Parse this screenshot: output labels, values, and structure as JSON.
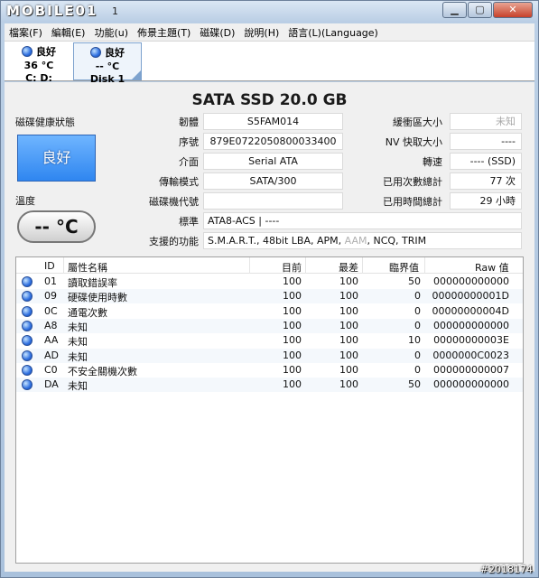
{
  "window": {
    "logo": "MOBILE01",
    "title": "1"
  },
  "menu": [
    "檔案(F)",
    "編輯(E)",
    "功能(u)",
    "佈景主題(T)",
    "磁碟(D)",
    "說明(H)",
    "語言(L)(Language)"
  ],
  "disk_tabs": [
    {
      "status": "良好",
      "temp": "36 °C",
      "drive": "C: D:"
    },
    {
      "status": "良好",
      "temp": "-- °C",
      "drive": "Disk 1"
    }
  ],
  "model": "SATA SSD  20.0 GB",
  "left_panel": {
    "health_label": "磁碟健康狀態",
    "health_value": "良好",
    "temp_label": "溫度",
    "temp_value": "-- °C"
  },
  "info": {
    "firmware_label": "韌體",
    "firmware": "S5FAM014",
    "serial_label": "序號",
    "serial": "879E0722050800033400",
    "interface_label": "介面",
    "interface": "Serial ATA",
    "transfer_label": "傳輸模式",
    "transfer": "SATA/300",
    "drive_letter_label": "磁碟機代號",
    "drive_letter": "",
    "standard_label": "標準",
    "standard": "ATA8-ACS | ----",
    "features_label": "支援的功能",
    "features_a": "S.M.A.R.T., 48bit LBA, APM, ",
    "features_aam": "AAM",
    "features_b": ", NCQ, TRIM",
    "buffer_label": "緩衝區大小",
    "buffer": "未知",
    "nvcache_label": "NV 快取大小",
    "nvcache": "----",
    "rotation_label": "轉速",
    "rotation": "---- (SSD)",
    "power_count_label": "已用次數總計",
    "power_count": "77 次",
    "power_hours_label": "已用時間總計",
    "power_hours": "29 小時"
  },
  "smart_table": {
    "headers": [
      "ID",
      "屬性名稱",
      "目前",
      "最差",
      "臨界值",
      "Raw 值"
    ],
    "rows": [
      {
        "id": "01",
        "name": "讀取錯誤率",
        "current": "100",
        "worst": "100",
        "threshold": "50",
        "raw": "000000000000"
      },
      {
        "id": "09",
        "name": "硬碟使用時數",
        "current": "100",
        "worst": "100",
        "threshold": "0",
        "raw": "00000000001D"
      },
      {
        "id": "0C",
        "name": "通電次數",
        "current": "100",
        "worst": "100",
        "threshold": "0",
        "raw": "00000000004D"
      },
      {
        "id": "A8",
        "name": "未知",
        "current": "100",
        "worst": "100",
        "threshold": "0",
        "raw": "000000000000"
      },
      {
        "id": "AA",
        "name": "未知",
        "current": "100",
        "worst": "100",
        "threshold": "10",
        "raw": "00000000003E"
      },
      {
        "id": "AD",
        "name": "未知",
        "current": "100",
        "worst": "100",
        "threshold": "0",
        "raw": "0000000C0023"
      },
      {
        "id": "C0",
        "name": "不安全關機次數",
        "current": "100",
        "worst": "100",
        "threshold": "0",
        "raw": "000000000007"
      },
      {
        "id": "DA",
        "name": "未知",
        "current": "100",
        "worst": "100",
        "threshold": "50",
        "raw": "000000000000"
      }
    ]
  },
  "watermark": "#2018174",
  "colors": {
    "status_good": "#3a8cf0",
    "accent": "#2e6fe0"
  }
}
